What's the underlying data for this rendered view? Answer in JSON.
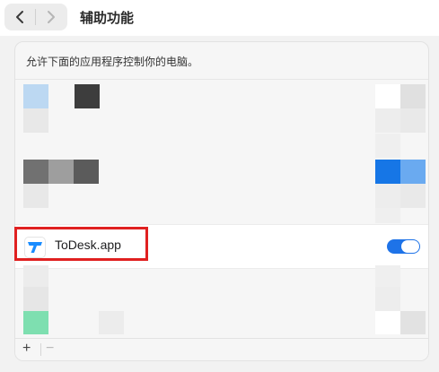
{
  "header": {
    "title": "辅助功能",
    "back_icon": "chevron-left-icon",
    "forward_icon": "chevron-right-icon"
  },
  "panel": {
    "description": "允许下面的应用程序控制你的电脑。",
    "highlighted_app": {
      "name": "ToDesk.app",
      "icon": "todesk-icon",
      "enabled": true
    },
    "footer": {
      "add_label": "+",
      "remove_label": "−"
    }
  },
  "colors": {
    "toggle_on": "#1e73e8",
    "highlight_border": "#e02020",
    "todesk_blue": "#1a8cff"
  }
}
